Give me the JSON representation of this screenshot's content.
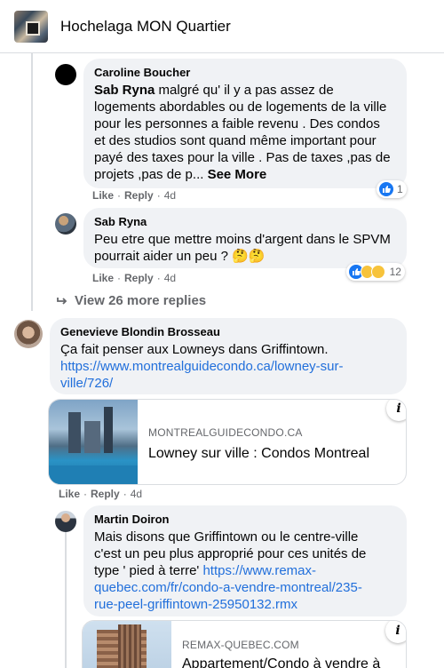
{
  "header": {
    "group_name": "Hochelaga MON Quartier"
  },
  "comments": [
    {
      "author": "Caroline Boucher",
      "mention": "Sab Ryna",
      "lines": [
        " malgré qu' il y a pas assez de",
        "logements abordables ou de logements de la ville",
        "pour les personnes a faible revenu . Des condos",
        "et des studios sont quand même important pour",
        "payé des taxes pour la ville . Pas de taxes ,pas de",
        "projets ,pas de p... "
      ],
      "see_more": "See More",
      "like": "Like",
      "reply": "Reply",
      "time": "4d",
      "reaction_count": "1"
    },
    {
      "author": "Sab Ryna",
      "lines": [
        "Peu etre que mettre moins d'argent dans le SPVM",
        "pourrait aider un peu ? 🤔🤔"
      ],
      "like": "Like",
      "reply": "Reply",
      "time": "4d",
      "reaction_count": "12"
    },
    {
      "author": "Genevieve Blondin Brosseau",
      "line": "Ça fait penser aux Lowneys dans Griffintown.",
      "link_lines": [
        "https://www.montrealguidecondo.ca/lowney-sur-",
        "ville/726/"
      ],
      "card": {
        "domain": "MONTREALGUIDECONDO.CA",
        "title": "Lowney sur ville : Condos Montreal"
      },
      "like": "Like",
      "reply": "Reply",
      "time": "4d"
    },
    {
      "author": "Martin Doiron",
      "lines": [
        "Mais disons que Griffintown ou le centre-ville",
        "c'est un peu plus approprié pour ces unités de"
      ],
      "line3_text": "type ' pied à terre' ",
      "link_lines": [
        "https://www.remax-",
        "quebec.com/fr/condo-a-vendre-montreal/235-",
        "rue-peel-griffintown-25950132.rmx"
      ],
      "card": {
        "domain": "REMAX-QUEBEC.COM",
        "title": "Appartement/Condo à vendre à"
      }
    }
  ],
  "view_more": "View 26 more replies",
  "info_glyph": "i",
  "colors": {
    "link": "#216fdb",
    "bubble": "#f0f2f5",
    "meta": "#65676b",
    "like_blue": "#1877f2"
  }
}
